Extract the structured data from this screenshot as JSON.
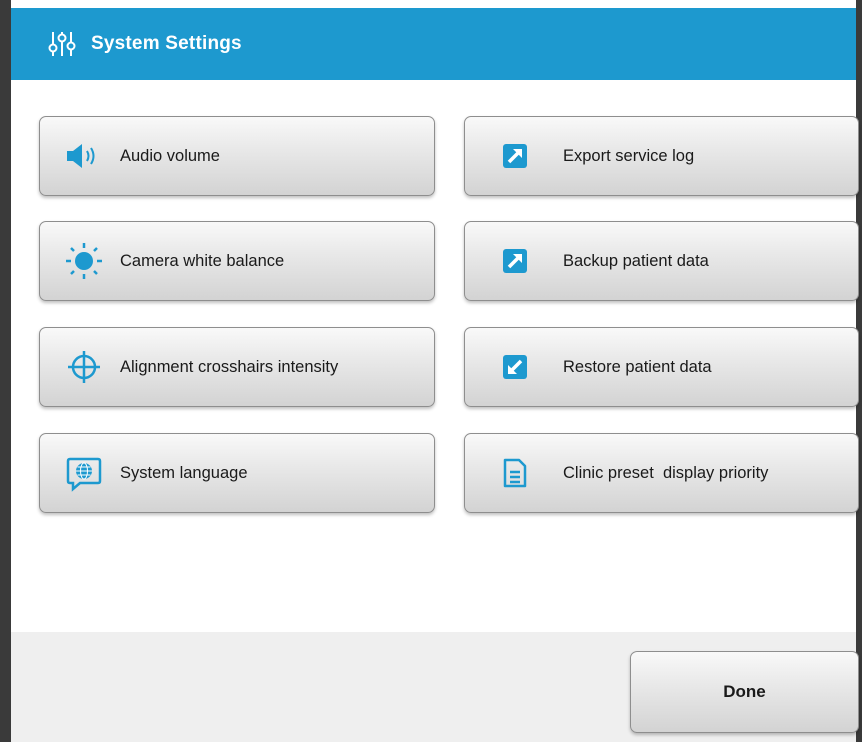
{
  "header": {
    "title": "System Settings",
    "icon": "sliders-icon",
    "background": "#1d99cf"
  },
  "left_buttons": [
    {
      "label": "Audio volume",
      "icon": "speaker-icon"
    },
    {
      "label": "Camera white balance",
      "icon": "sun-icon"
    },
    {
      "label": "Alignment crosshairs intensity",
      "icon": "crosshair-icon"
    },
    {
      "label": "System language",
      "icon": "globe-speech-icon"
    }
  ],
  "right_buttons": [
    {
      "label": "Export service log",
      "icon": "export-icon"
    },
    {
      "label": "Backup patient data",
      "icon": "export-icon"
    },
    {
      "label": "Restore patient data",
      "icon": "import-icon"
    },
    {
      "label": "Clinic preset  display priority",
      "icon": "document-icon"
    }
  ],
  "footer": {
    "done_label": "Done"
  },
  "colors": {
    "accent": "#1d99cf",
    "footer_bg": "#efefef"
  }
}
